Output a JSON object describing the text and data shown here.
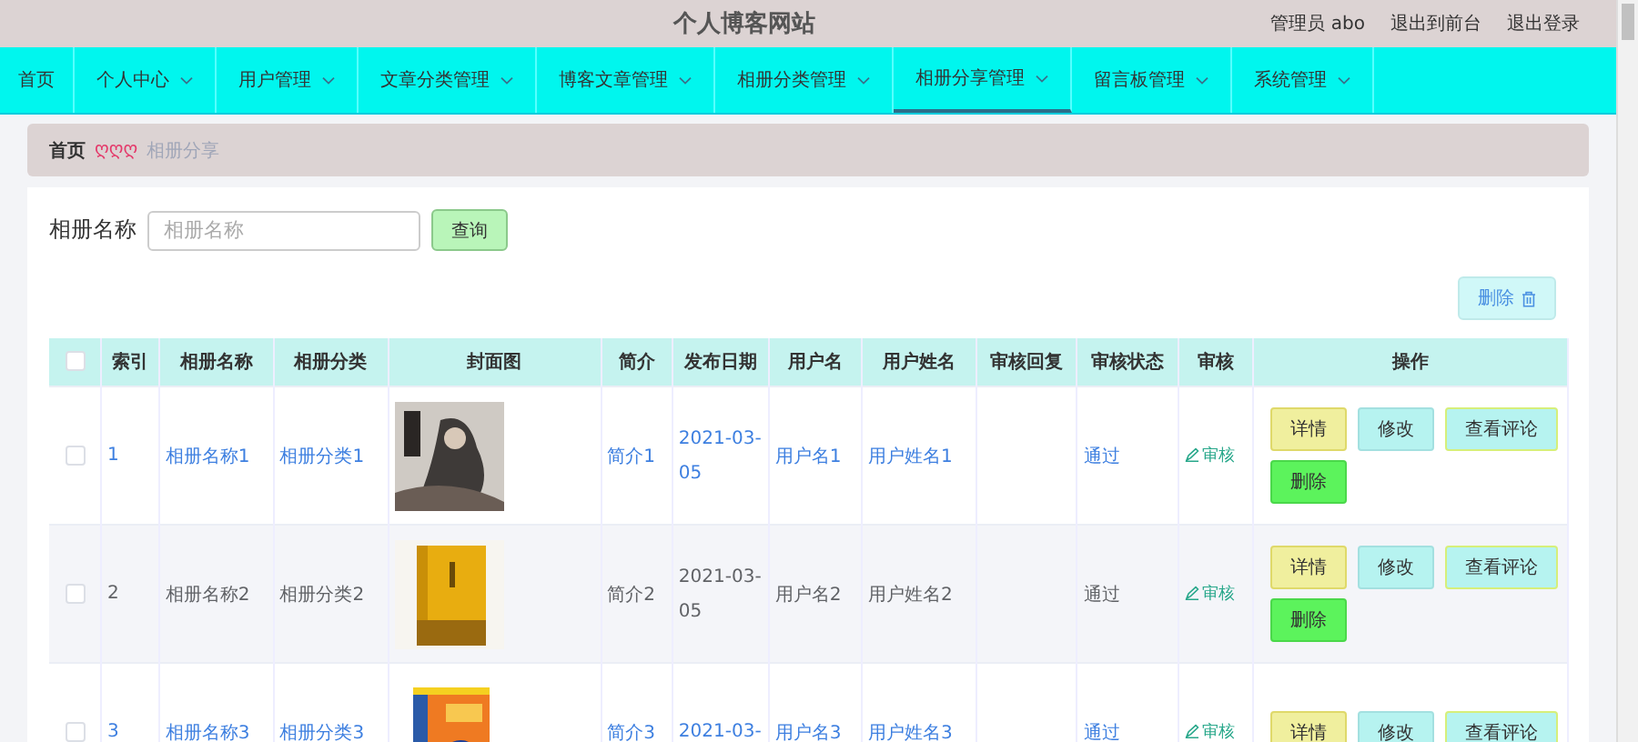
{
  "header": {
    "title": "个人博客网站",
    "user": "管理员 abo",
    "links": [
      "退出到前台",
      "退出登录"
    ]
  },
  "nav": [
    {
      "label": "首页",
      "dropdown": false,
      "selected": false
    },
    {
      "label": "个人中心",
      "dropdown": true,
      "selected": false
    },
    {
      "label": "用户管理",
      "dropdown": true,
      "selected": false
    },
    {
      "label": "文章分类管理",
      "dropdown": true,
      "selected": false
    },
    {
      "label": "博客文章管理",
      "dropdown": true,
      "selected": false
    },
    {
      "label": "相册分类管理",
      "dropdown": true,
      "selected": false
    },
    {
      "label": "相册分享管理",
      "dropdown": true,
      "selected": true
    },
    {
      "label": "留言板管理",
      "dropdown": true,
      "selected": false
    },
    {
      "label": "系统管理",
      "dropdown": true,
      "selected": false
    }
  ],
  "breadcrumb": {
    "home": "首页",
    "separator": "ღღღ",
    "current": "相册分享"
  },
  "search": {
    "label": "相册名称",
    "placeholder": "相册名称",
    "button": "查询"
  },
  "delete_button": "删除",
  "table": {
    "columns": [
      "索引",
      "相册名称",
      "相册分类",
      "封面图",
      "简介",
      "发布日期",
      "用户名",
      "用户姓名",
      "审核回复",
      "审核状态",
      "审核",
      "操作"
    ],
    "header_checked": false,
    "rows": [
      {
        "checked": false,
        "highlighted": true,
        "index": "1",
        "name": "相册名称1",
        "category": "相册分类1",
        "cover": {
          "kind": "picture"
        },
        "intro": "简介1",
        "date": "2021-03-05",
        "username": "用户名1",
        "realname": "用户姓名1",
        "status": "通过",
        "review": "审核",
        "actions": [
          "详情",
          "修改",
          "查看评论",
          "删除"
        ]
      },
      {
        "checked": false,
        "highlighted": false,
        "index": "2",
        "name": "相册名称2",
        "category": "相册分类2",
        "cover": {
          "kind": "picture"
        },
        "intro": "简介2",
        "date": "2021-03-05",
        "username": "用户名2",
        "realname": "用户姓名2",
        "status": "通过",
        "review": "审核",
        "actions": [
          "详情",
          "修改",
          "查看评论",
          "删除"
        ]
      },
      {
        "checked": false,
        "highlighted": true,
        "index": "3",
        "name": "相册名称3",
        "category": "相册分类3",
        "cover": {
          "kind": "picture"
        },
        "intro": "简介3",
        "date": "2021-03-",
        "username": "用户名3",
        "realname": "用户姓名3",
        "status": "通过",
        "review": "审核",
        "actions": [
          "详情",
          "修改",
          "查看评论"
        ]
      }
    ]
  }
}
